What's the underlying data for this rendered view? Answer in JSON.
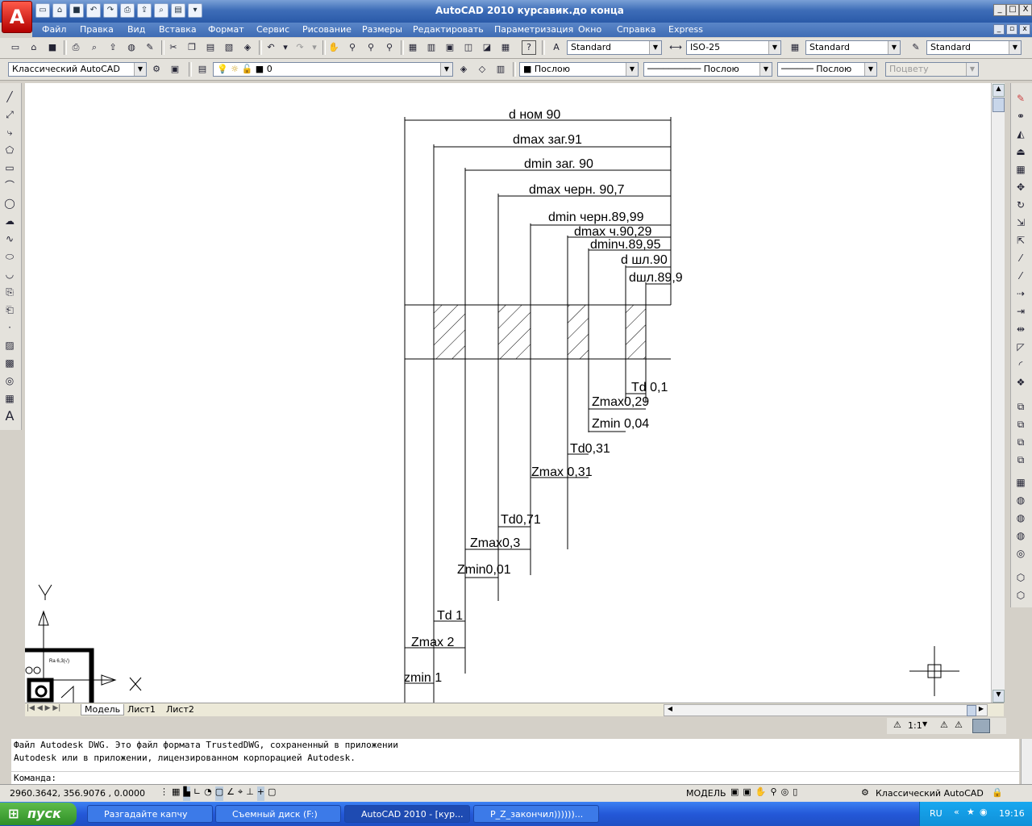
{
  "titlebar": {
    "app_button": "A",
    "title": "AutoCAD 2010    курсавик.до конца",
    "min": "_",
    "max": "□",
    "close": "X"
  },
  "menu": [
    "Файл",
    "Правка",
    "Вид",
    "Вставка",
    "Формат",
    "Сервис",
    "Рисование",
    "Размеры",
    "Редактировать",
    "Параметризация",
    "Окно",
    "Справка",
    "Express"
  ],
  "toolbar1": {
    "text_style": "Standard",
    "dim_style": "ISO-25",
    "table_style": "Standard",
    "mleader_style": "Standard"
  },
  "toolbar2": {
    "workspace": "Классический AutoCAD",
    "layer": "0",
    "color": "Послою",
    "linetype": "Послою",
    "lineweight": "Послою",
    "plotstyle": "Поцвету"
  },
  "drawing": {
    "labels": [
      "d ном 90",
      "dmax заг.91",
      "dmin заг. 90",
      "dmax черн. 90,7",
      "dmin черн.89,99",
      "dmax ч.90,29",
      "dminч.89,95",
      "d шл.90",
      "dшл.89,9",
      "Td 0,1",
      "Zmax0,29",
      "Zmin 0,04",
      "Td0,31",
      "Zmax 0,31",
      "Td0,71",
      "Zmax0,3",
      "Zmin0,01",
      "Td 1",
      "Zmax 2",
      "zmin 1"
    ],
    "ucs_y": "Y",
    "ucs_x": "X",
    "inset_text": "Ra 6,3(√)"
  },
  "tabs": [
    "Модель",
    "Лист1",
    "Лист2"
  ],
  "annotation_scale": "1:1",
  "command": {
    "line1": "Файл Autodesk DWG. Это файл формата TrustedDWG, сохраненный в приложении",
    "line2": "Autodesk или в приложении, лицензированном корпорацией Autodesk.",
    "prompt": "Команда:"
  },
  "status": {
    "coords": "2960.3642, 356.9076 , 0.0000",
    "model": "МОДЕЛЬ",
    "workspace": "Классический AutoCAD"
  },
  "taskbar": {
    "start": "пуск",
    "tasks": [
      "Разгадайте капчу",
      "Съемный диск (F:)",
      "AutoCAD 2010 - [кур...",
      "P_Z_закончил))))))..."
    ],
    "lang": "RU",
    "time": "19:16"
  }
}
